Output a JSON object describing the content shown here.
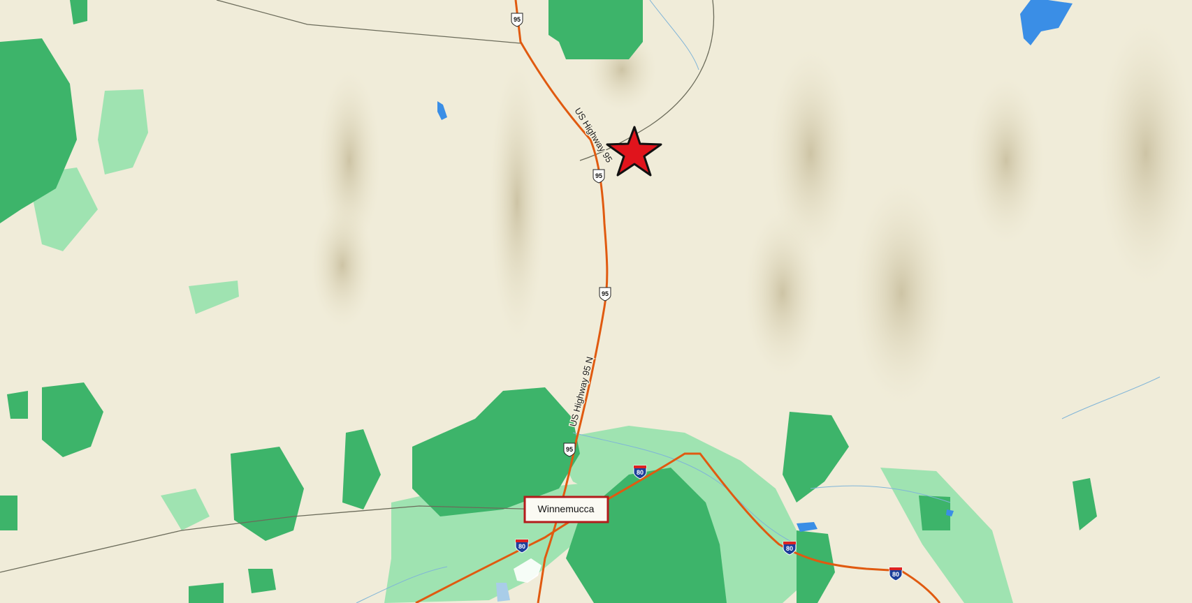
{
  "map": {
    "labels": {
      "city": "Winnemucca",
      "road_upper": "US Highway 95",
      "road_lower": "US Highway 95 N"
    },
    "shields": {
      "us95": "95",
      "i80": "80"
    },
    "marker": {
      "type": "star",
      "color": "#e0141c"
    },
    "colors": {
      "land": "#f0ecd9",
      "forest": "#3db46a",
      "forest_light": "#9fe3b1",
      "water": "#3a8ee6",
      "road": "#e05a10"
    }
  }
}
